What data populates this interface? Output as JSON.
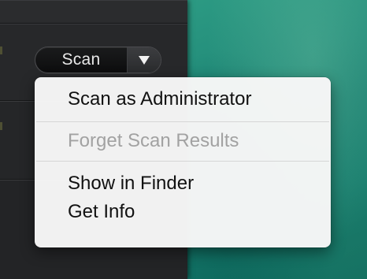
{
  "scan_button": {
    "label": "Scan",
    "dropdown_icon": "triangle-down-icon"
  },
  "context_menu": {
    "items": [
      {
        "label": "Scan as Administrator",
        "enabled": true
      },
      {
        "label": "Forget Scan Results",
        "enabled": false
      },
      {
        "label": "Show in Finder",
        "enabled": true
      },
      {
        "label": "Get Info",
        "enabled": true
      }
    ]
  },
  "colors": {
    "app_background": "#222325",
    "desktop_accent": "#1f8a78",
    "menu_background": "#f6f6f6",
    "menu_text": "#111111",
    "menu_text_disabled": "#a2a2a2"
  }
}
